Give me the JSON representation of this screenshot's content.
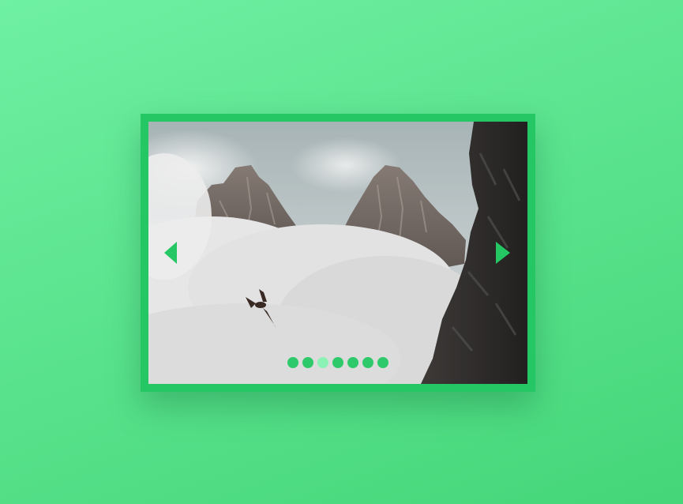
{
  "slider": {
    "slide_count": 7,
    "active_index": 2,
    "accent_color": "#25c765",
    "dot_color": "#2ec96b",
    "active_dot_color": "#8af2b4",
    "prev_icon": "caret-left-icon",
    "next_icon": "caret-right-icon"
  },
  "background": {
    "gradient_start": "#6ff0a3",
    "gradient_end": "#45d679"
  }
}
